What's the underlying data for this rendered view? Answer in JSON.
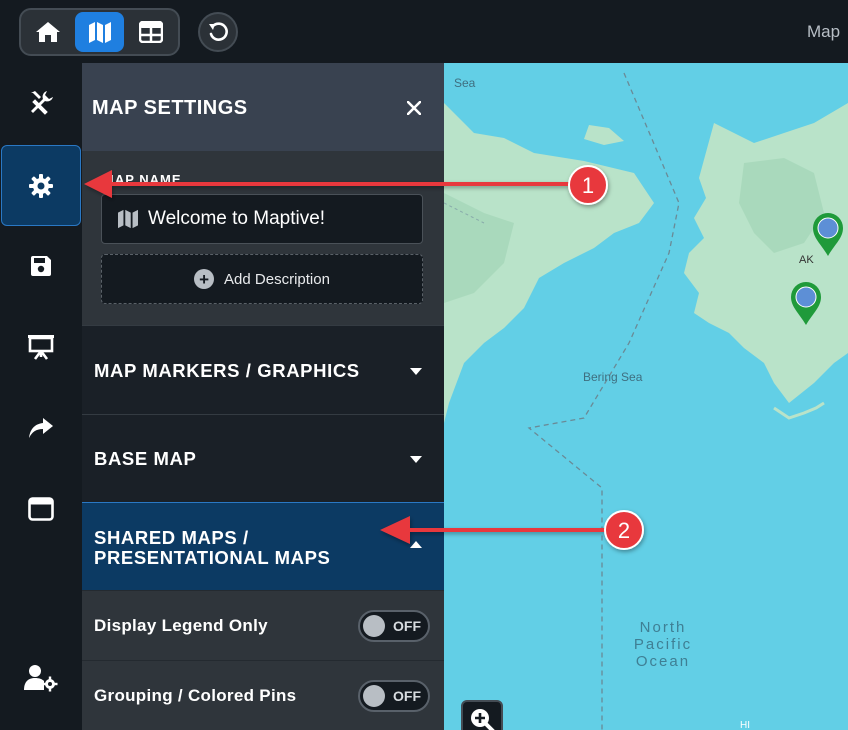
{
  "topbar": {
    "title": "Map",
    "nav": [
      {
        "icon": "home-icon"
      },
      {
        "icon": "map-icon",
        "active": true
      },
      {
        "icon": "table-icon"
      }
    ],
    "undo_icon": "undo-icon"
  },
  "rail": {
    "items": [
      {
        "icon": "tools-icon"
      },
      {
        "icon": "gear-icon",
        "active": true
      },
      {
        "icon": "save-icon"
      },
      {
        "icon": "presentation-icon"
      },
      {
        "icon": "share-icon"
      },
      {
        "icon": "window-icon"
      },
      {
        "icon": "user-settings-icon"
      }
    ]
  },
  "panel": {
    "title": "MAP SETTINGS",
    "map_name_label": "MAP NAME",
    "map_name_value": "Welcome to Maptive!",
    "add_description": "Add Description",
    "sections": {
      "markers": "MAP MARKERS / GRAPHICS",
      "base_map": "BASE MAP",
      "shared_line1": "SHARED MAPS /",
      "shared_line2": "PRESENTATIONAL MAPS"
    },
    "toggles": [
      {
        "label": "Display Legend Only",
        "state": "OFF"
      },
      {
        "label": "Grouping / Colored Pins",
        "state": "OFF"
      }
    ]
  },
  "map": {
    "labels": {
      "sea_top": "Sea",
      "bering": "Bering Sea",
      "ak": "AK",
      "hi": "HI",
      "ocean_line1": "North",
      "ocean_line2": "Pacific",
      "ocean_line3": "Ocean"
    },
    "colors": {
      "water": "#62cfe6",
      "land": "#b9e3c9",
      "pin": "#1f9a3a"
    }
  },
  "annotations": {
    "badge1": "1",
    "badge2": "2",
    "color": "#e8383d"
  }
}
